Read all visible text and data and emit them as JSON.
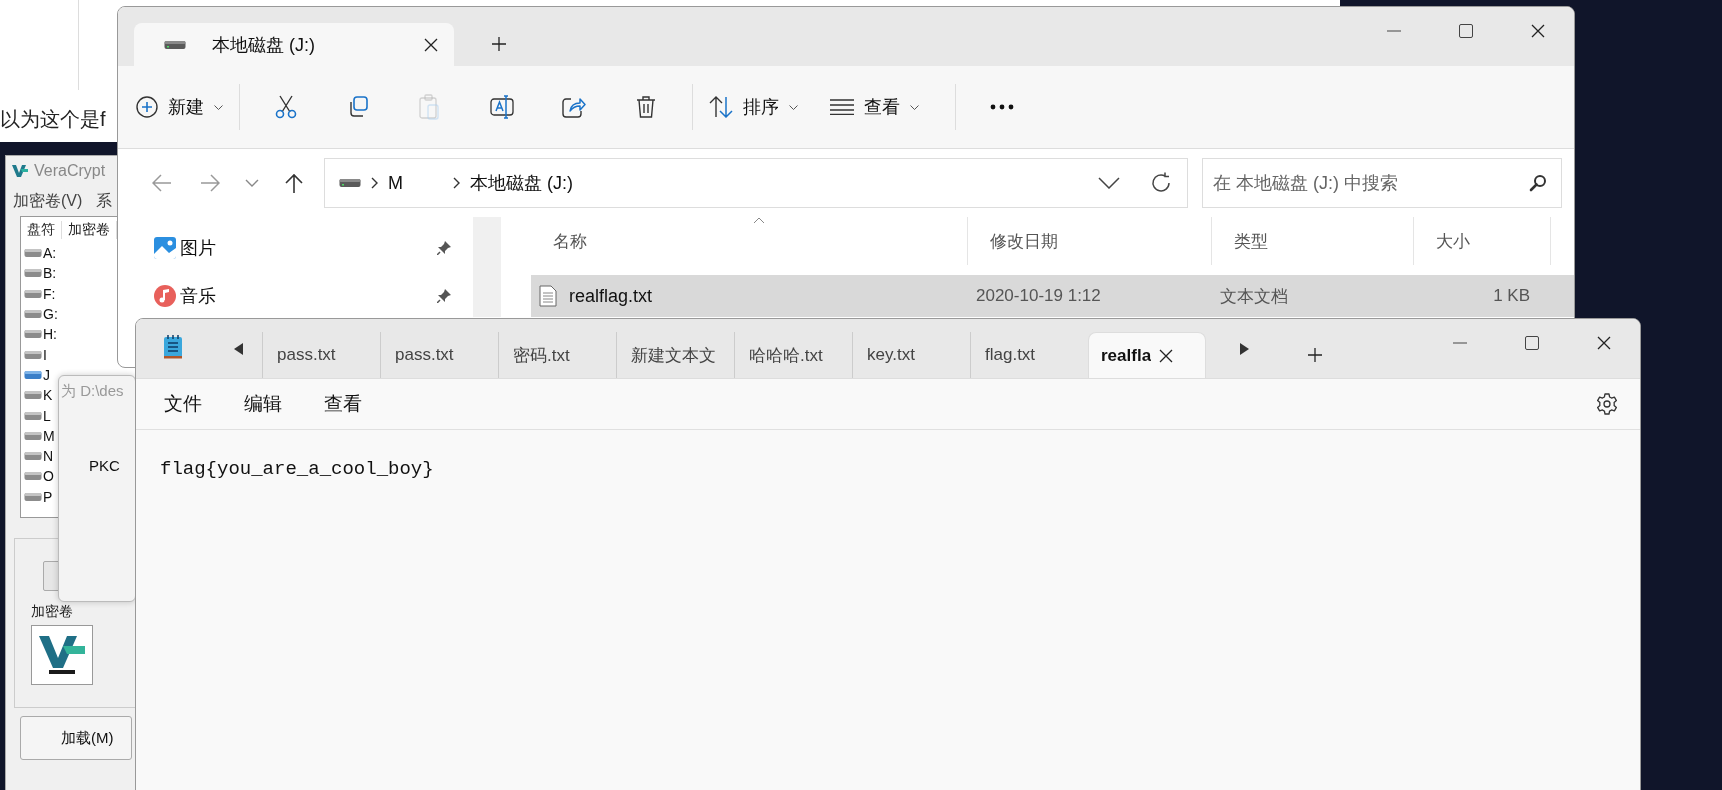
{
  "background_page": {
    "text": "以为这个是f"
  },
  "veracrypt": {
    "title": "VeraCrypt",
    "menu": [
      "加密卷(V)",
      "系"
    ],
    "columns": [
      "盘符",
      "加密卷"
    ],
    "drives": [
      {
        "label": "A:",
        "mounted": false
      },
      {
        "label": "B:",
        "mounted": false
      },
      {
        "label": "F:",
        "mounted": false
      },
      {
        "label": "G:",
        "mounted": false
      },
      {
        "label": "H:",
        "mounted": false
      },
      {
        "label": "I",
        "mounted": false
      },
      {
        "label": "J",
        "mounted": true
      },
      {
        "label": "K",
        "mounted": false
      },
      {
        "label": "L",
        "mounted": false
      },
      {
        "label": "M",
        "mounted": false
      },
      {
        "label": "N",
        "mounted": false
      },
      {
        "label": "O",
        "mounted": false
      },
      {
        "label": "P",
        "mounted": false
      }
    ],
    "volume_label": "加密卷",
    "mount_button": "加载(M)"
  },
  "dialog": {
    "title": "为 D:\\des",
    "text": "PKC"
  },
  "explorer": {
    "tabs": [
      {
        "label": "本地磁盘 (J:)",
        "selected": true
      }
    ],
    "toolbar": [
      {
        "kind": "new",
        "label": "新建",
        "disabled": false
      },
      {
        "kind": "cut",
        "disabled": false
      },
      {
        "kind": "copy",
        "disabled": false
      },
      {
        "kind": "paste",
        "disabled": true
      },
      {
        "kind": "rename",
        "disabled": false
      },
      {
        "kind": "share",
        "disabled": false
      },
      {
        "kind": "delete",
        "disabled": false
      },
      {
        "kind": "sort",
        "label": "排序",
        "disabled": false
      },
      {
        "kind": "view",
        "label": "查看",
        "disabled": false
      },
      {
        "kind": "more",
        "disabled": false
      }
    ],
    "breadcrumb": [
      "M",
      "本地磁盘 (J:)"
    ],
    "search": {
      "placeholder": "在 本地磁盘 (J:) 中搜索"
    },
    "nav_items": [
      {
        "kind": "pictures",
        "label": "图片"
      },
      {
        "kind": "music",
        "label": "音乐"
      }
    ],
    "columns": [
      "名称",
      "修改日期",
      "类型",
      "大小"
    ],
    "rows": [
      {
        "name": "realflag.txt",
        "modified": "2020-10-19 1:12",
        "type": "文本文档",
        "size": "1 KB",
        "selected": true
      }
    ]
  },
  "notepad": {
    "tabs": [
      {
        "label": "pass.txt",
        "selected": false
      },
      {
        "label": "pass.txt",
        "selected": false
      },
      {
        "label": "密码.txt",
        "selected": false
      },
      {
        "label": "新建文本文",
        "selected": false
      },
      {
        "label": "哈哈哈.txt",
        "selected": false
      },
      {
        "label": "key.txt",
        "selected": false
      },
      {
        "label": "flag.txt",
        "selected": false
      },
      {
        "label": "realfla",
        "selected": true
      }
    ],
    "menu": [
      "文件",
      "编辑",
      "查看"
    ],
    "content": "flag{you_are_a_cool_boy}"
  }
}
